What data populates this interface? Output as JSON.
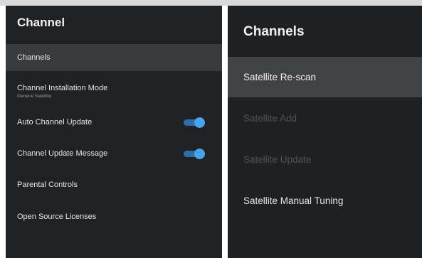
{
  "channel_menu": {
    "title": "Channel",
    "items": [
      {
        "label": "Channels",
        "sub": "",
        "toggle": null,
        "selected": true
      },
      {
        "label": "Channel Installation Mode",
        "sub": "General Satellite",
        "toggle": null,
        "selected": false
      },
      {
        "label": "Auto Channel Update",
        "sub": "",
        "toggle": "on",
        "selected": false
      },
      {
        "label": "Channel Update Message",
        "sub": "",
        "toggle": "on",
        "selected": false
      },
      {
        "label": "Parental Controls",
        "sub": "",
        "toggle": null,
        "selected": false
      },
      {
        "label": "Open Source Licenses",
        "sub": "",
        "toggle": null,
        "selected": false
      }
    ]
  },
  "channels_submenu": {
    "title": "Channels",
    "items": [
      {
        "label": "Satellite Re-scan",
        "enabled": true,
        "selected": true
      },
      {
        "label": "Satellite Add",
        "enabled": false,
        "selected": false
      },
      {
        "label": "Satellite Update",
        "enabled": false,
        "selected": false
      },
      {
        "label": "Satellite Manual Tuning",
        "enabled": true,
        "selected": false
      }
    ]
  },
  "colors": {
    "panel_bg": "#202124",
    "selected_bg": "#3a3b3e",
    "toggle_on": "#4aa3ea",
    "text": "#e6e6e6",
    "disabled_text": "#505154"
  },
  "icons": {
    "toggle": "toggle-switch-icon"
  }
}
